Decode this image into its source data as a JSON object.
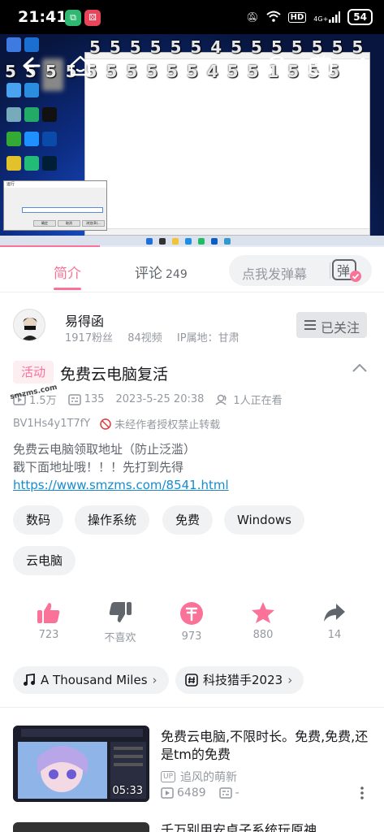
{
  "status_bar": {
    "time": "21:41",
    "signal_label": "4G+",
    "hd_label": "HD",
    "battery": "54"
  },
  "player": {
    "danmaku": [
      "5 5 5 5  5 5 4 5 5 5    5 5 5 5",
      "5 5  5   5  5 5 5   5 5 5  4 5 5   1 5 5 5"
    ],
    "progress_fraction": 0.26,
    "controls": [
      "back-icon",
      "home-icon",
      "listen-icon",
      "tv-cast-icon",
      "more-icon"
    ],
    "run_dialog": {
      "title": "运行",
      "ok": "确定",
      "cancel": "取消",
      "browse": "浏览(B)..."
    }
  },
  "tabs": {
    "intro": "简介",
    "comments": "评论",
    "comments_count": "249",
    "danmaku_placeholder": "点我发弹幕",
    "danmaku_button": "弹"
  },
  "uploader": {
    "name": "易得函",
    "followers": "1917粉丝",
    "videos": "84视频",
    "ip": "IP属地：甘肃",
    "follow_label": "已关注"
  },
  "video": {
    "badge": "活动",
    "title": "免费云电脑复活",
    "views": "1.5万",
    "danmaku_count": "135",
    "date": "2023-5-25 20:38",
    "watching": "1人正在看",
    "bvid": "BV1Hs4y1T7fY",
    "copyright": "未经作者授权禁止转载",
    "watermark": "smzms.com",
    "desc_line1": "免费云电脑领取地址（防止泛滥）",
    "desc_line2": "戳下面地址哦！！！先打到先得",
    "desc_link": "https://www.smzms.com/8541.html"
  },
  "tags": [
    "数码",
    "操作系统",
    "免费",
    "Windows",
    "云电脑"
  ],
  "actions": {
    "like": "723",
    "dislike": "不喜欢",
    "coin": "973",
    "favorite": "880",
    "share": "14"
  },
  "chips": {
    "music": "A Thousand Miles",
    "topic": "科技猎手2023"
  },
  "recommended": [
    {
      "title": "免费云电脑,不限时长。免费,免费,还是tm的免费",
      "up_badge": "UP",
      "uploader": "追风的萌新",
      "views": "6489",
      "danmaku": "-",
      "duration": "05:33"
    },
    {
      "title": "千万别用安卓子系统玩原神"
    }
  ],
  "colors": {
    "accent": "#fb7299",
    "link": "#178bcf",
    "muted": "#9499a0"
  }
}
